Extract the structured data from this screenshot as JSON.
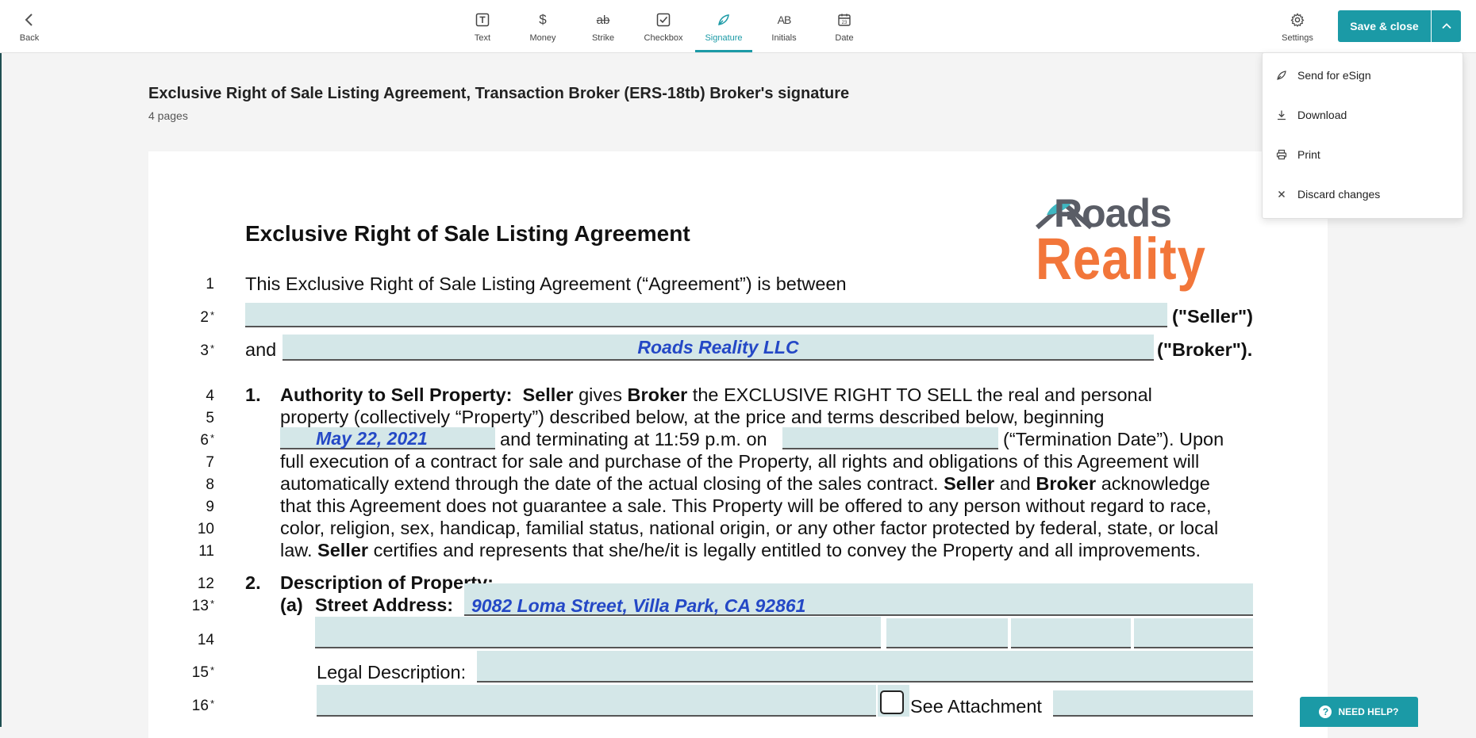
{
  "toolbar": {
    "back_label": "Back",
    "tools": [
      {
        "label": "Text",
        "icon": "text-icon"
      },
      {
        "label": "Money",
        "icon": "dollar-icon"
      },
      {
        "label": "Strike",
        "icon": "strikethrough-icon"
      },
      {
        "label": "Checkbox",
        "icon": "checkbox-icon"
      },
      {
        "label": "Signature",
        "icon": "pen-nib-icon",
        "active": true
      },
      {
        "label": "Initials",
        "icon": "initials-icon"
      },
      {
        "label": "Date",
        "icon": "calendar-icon"
      }
    ],
    "settings_label": "Settings",
    "save_label": "Save & close",
    "accent_color": "#1b9aa6"
  },
  "dropdown": {
    "items": [
      {
        "label": "Send for eSign",
        "icon": "pen-nib-icon"
      },
      {
        "label": "Download",
        "icon": "download-icon"
      },
      {
        "label": "Print",
        "icon": "printer-icon"
      },
      {
        "label": "Discard changes",
        "icon": "close-icon"
      }
    ]
  },
  "header": {
    "title": "Exclusive Right of Sale Listing Agreement, Transaction Broker (ERS-18tb) Broker's signature",
    "pages": "4 pages"
  },
  "document": {
    "heading": "Exclusive Right of Sale Listing Agreement",
    "logo_top": "Roads",
    "logo_bottom": "Reality",
    "line_numbers": [
      "1",
      "2",
      "3",
      "4",
      "5",
      "6",
      "7",
      "8",
      "9",
      "10",
      "11",
      "12",
      "13",
      "14",
      "15",
      "16"
    ],
    "required_mark": "*",
    "line1": "This Exclusive Right of Sale Listing Agreement (“Agreement”) is between",
    "seller_suffix": "(\"Seller\")",
    "and": "and",
    "broker_value": "Roads Reality LLC",
    "broker_suffix": "(\"Broker\").",
    "s1_num": "1.",
    "s1_title": "Authority to Sell Property:",
    "s1_seller": "Seller",
    "s1_gives": "gives",
    "s1_broker": "Broker",
    "s1_rest": "the EXCLUSIVE RIGHT TO SELL the real and personal",
    "line5": "property (collectively “Property”) described below, at the price and terms described below, beginning",
    "start_date": "May 22, 2021",
    "line6_mid": "and terminating at 11:59 p.m. on",
    "line6_end": "(“Termination Date”). Upon",
    "line7": "full execution of a contract for sale and purchase of the Property, all rights and obligations of this Agreement will",
    "line8_a": "automatically extend through the date of the actual closing of the sales contract.",
    "line8_seller": "Seller",
    "line8_and": "and",
    "line8_broker": "Broker",
    "line8_end": "acknowledge",
    "line9": "that this Agreement does not guarantee a sale. This Property will be offered to any person without regard to race,",
    "line10": "color, religion, sex, handicap, familial status, national origin, or any other factor protected by federal, state, or local",
    "line11_a": "law.",
    "line11_seller": "Seller",
    "line11_b": "certifies and represents that she/he/it is legally entitled to convey the Property and all improvements.",
    "s2_num": "2.",
    "s2_title": "Description of Property:",
    "s2a": "(a)",
    "street_label": "Street Address:",
    "street_value": "9082 Loma Street, Villa Park, CA 92861",
    "legal_label": "Legal Description:",
    "see_attachment": "See Attachment"
  },
  "help": {
    "label": "NEED HELP?"
  }
}
